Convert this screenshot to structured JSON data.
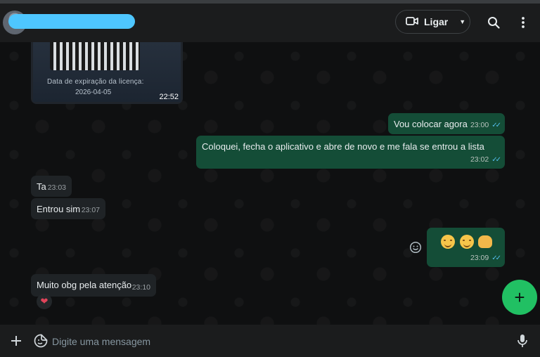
{
  "header": {
    "call_label": "Ligar"
  },
  "image_message": {
    "caption_line1": "Data de expiração da licença:",
    "caption_line2": "2026-04-05",
    "time": "22:52"
  },
  "messages": [
    {
      "direction": "out",
      "text": "Vou colocar agora",
      "time": "23:00",
      "ticks": "✓✓"
    },
    {
      "direction": "out",
      "text": "Coloquei, fecha o aplicativo e abre de novo e me fala se entrou a lista",
      "time": "23:02",
      "ticks": "✓✓"
    },
    {
      "direction": "in",
      "text": "Ta",
      "time": "23:03"
    },
    {
      "direction": "in",
      "text": "Entrou sim",
      "time": "23:07"
    },
    {
      "direction": "out",
      "text": "",
      "time": "23:09",
      "ticks": "✓✓",
      "emojis": [
        "smiling-face",
        "smiling-face",
        "handshake"
      ]
    },
    {
      "direction": "in",
      "text": "Muito obg pela atenção",
      "time": "23:10",
      "reaction": "❤"
    }
  ],
  "composer": {
    "placeholder": "Digite uma mensagem"
  },
  "colors": {
    "outgoing_bubble": "#144d37",
    "incoming_bubble": "#1f2326",
    "accent_green": "#21c063",
    "read_ticks": "#53bdeb",
    "name_redaction": "#4ec6ff"
  },
  "icons": {
    "call": "video-camera-icon",
    "search": "search-icon",
    "menu": "kebab-menu-icon",
    "attach": "plus-icon",
    "sticker": "sticker-icon",
    "mic": "microphone-icon",
    "new": "plus-fab-icon",
    "react": "emoji-react-icon"
  }
}
